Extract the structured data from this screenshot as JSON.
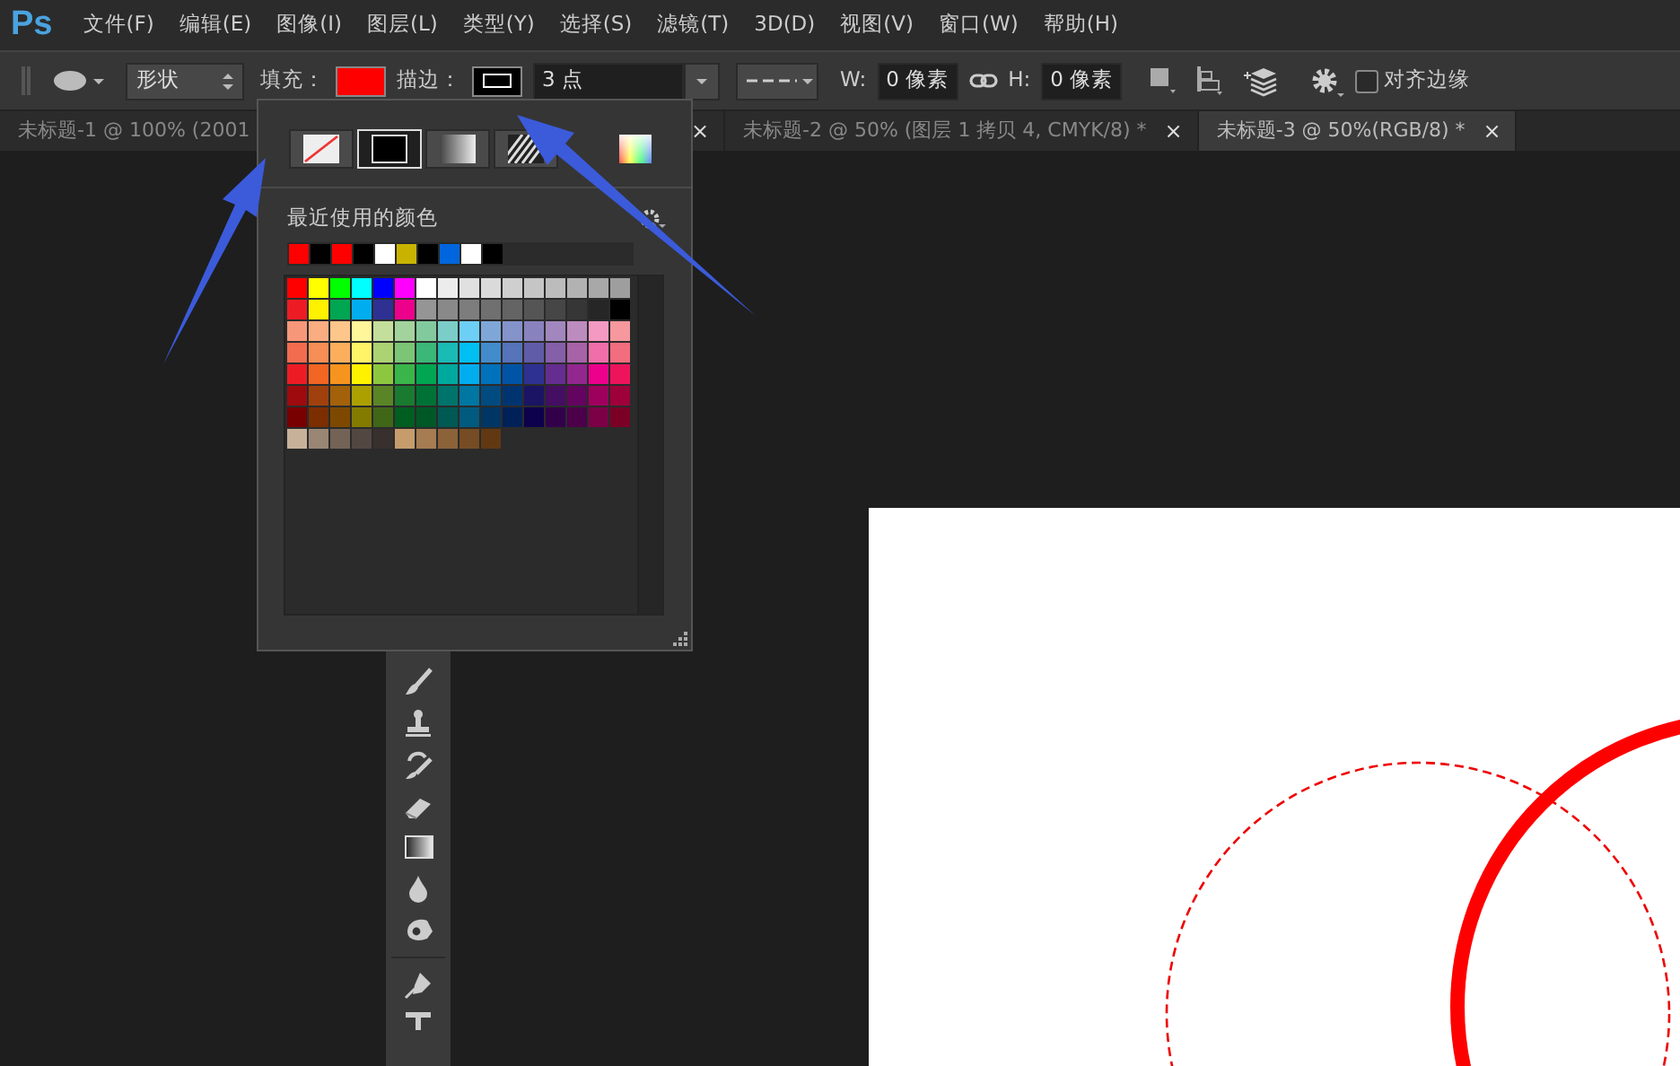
{
  "app_logo": "Ps",
  "menu": [
    "文件(F)",
    "编辑(E)",
    "图像(I)",
    "图层(L)",
    "类型(Y)",
    "选择(S)",
    "滤镜(T)",
    "3D(D)",
    "视图(V)",
    "窗口(W)",
    "帮助(H)"
  ],
  "options_bar": {
    "shape_mode": "形状",
    "fill_label": "填充：",
    "stroke_label": "描边：",
    "stroke_width": "3 点",
    "w_label": "W:",
    "w_value": "0 像素",
    "h_label": "H:",
    "h_value": "0 像素",
    "align_edges": {
      "label": "对齐边缘",
      "checked": false
    }
  },
  "tabs": [
    {
      "title": "未标题-1 @ 100% (2001",
      "close": "×",
      "selected": false
    },
    {
      "title": "未标题-2 @ 50% (图层 1 拷贝 4, CMYK/8) *",
      "close": "×",
      "selected": false
    },
    {
      "title": "未标题-3 @ 50%(RGB/8) *",
      "close": "×",
      "selected": true
    }
  ],
  "fill_popup": {
    "types": [
      {
        "kind": "none",
        "selected": false
      },
      {
        "kind": "solid",
        "selected": true
      },
      {
        "kind": "gradient",
        "selected": false
      },
      {
        "kind": "pattern",
        "selected": false
      }
    ],
    "recent_label": "最近使用的颜色",
    "recent": [
      {
        "color": "#ff0000"
      },
      {
        "color": "#000000"
      },
      {
        "color": "#ff0000"
      },
      {
        "color": "#000000"
      },
      {
        "color": "#ffffff"
      },
      {
        "color": "#c8b400"
      },
      {
        "color": "#000000"
      },
      {
        "color": "#0066dd"
      },
      {
        "color": "#ffffff"
      },
      {
        "color": "#000000"
      }
    ],
    "swatch_rows": [
      [
        {
          "color": "#ff0000"
        },
        {
          "color": "#ffff00"
        },
        {
          "color": "#00ff00"
        },
        {
          "color": "#00ffff"
        },
        {
          "color": "#0000ff"
        },
        {
          "color": "#ff00ff"
        },
        {
          "color": "#ffffff"
        },
        {
          "color": "#ececec"
        },
        {
          "color": "#e0e0e0"
        },
        {
          "color": "#dadada"
        },
        {
          "color": "#cfcfcf"
        },
        {
          "color": "#c5c5c5"
        },
        {
          "color": "#bcbcbc"
        },
        {
          "color": "#b2b2b2"
        },
        {
          "color": "#a8a8a8"
        },
        {
          "color": "#9e9e9e"
        }
      ],
      [
        {
          "color": "#ed1c24"
        },
        {
          "color": "#fff200"
        },
        {
          "color": "#00a651"
        },
        {
          "color": "#00aeef"
        },
        {
          "color": "#2e3192"
        },
        {
          "color": "#ec008c"
        },
        {
          "color": "#959595"
        },
        {
          "color": "#898989"
        },
        {
          "color": "#7d7d7d"
        },
        {
          "color": "#707070"
        },
        {
          "color": "#646464"
        },
        {
          "color": "#555555"
        },
        {
          "color": "#464646"
        },
        {
          "color": "#363636"
        },
        {
          "color": "#262626"
        },
        {
          "color": "#000000"
        }
      ],
      [
        {
          "color": "#f7977a"
        },
        {
          "color": "#f9ad81"
        },
        {
          "color": "#fdc68a"
        },
        {
          "color": "#fff79a"
        },
        {
          "color": "#c4df9b"
        },
        {
          "color": "#a3d39c"
        },
        {
          "color": "#82ca9d"
        },
        {
          "color": "#7bcdc8"
        },
        {
          "color": "#6ecff6"
        },
        {
          "color": "#7ea7d8"
        },
        {
          "color": "#8493ca"
        },
        {
          "color": "#8882be"
        },
        {
          "color": "#a187be"
        },
        {
          "color": "#bc8cbf"
        },
        {
          "color": "#f49ac2"
        },
        {
          "color": "#f6989d"
        }
      ],
      [
        {
          "color": "#f26c4f"
        },
        {
          "color": "#f68e55"
        },
        {
          "color": "#fbaf5c"
        },
        {
          "color": "#fff467"
        },
        {
          "color": "#acd372"
        },
        {
          "color": "#7cc576"
        },
        {
          "color": "#3bb878"
        },
        {
          "color": "#1abbb4"
        },
        {
          "color": "#00bff3"
        },
        {
          "color": "#438ccb"
        },
        {
          "color": "#5574b9"
        },
        {
          "color": "#605ca8"
        },
        {
          "color": "#855fa8"
        },
        {
          "color": "#a763a8"
        },
        {
          "color": "#f06ea9"
        },
        {
          "color": "#f26d7d"
        }
      ],
      [
        {
          "color": "#ed1c24"
        },
        {
          "color": "#f26522"
        },
        {
          "color": "#f7941d"
        },
        {
          "color": "#fff200"
        },
        {
          "color": "#8dc73f"
        },
        {
          "color": "#39b54a"
        },
        {
          "color": "#00a651"
        },
        {
          "color": "#00a99d"
        },
        {
          "color": "#00aeef"
        },
        {
          "color": "#0072bc"
        },
        {
          "color": "#0054a6"
        },
        {
          "color": "#2e3192"
        },
        {
          "color": "#662d91"
        },
        {
          "color": "#92278f"
        },
        {
          "color": "#ec008c"
        },
        {
          "color": "#ed145b"
        }
      ],
      [
        {
          "color": "#9e0b0f"
        },
        {
          "color": "#a0410d"
        },
        {
          "color": "#a36209"
        },
        {
          "color": "#aba000"
        },
        {
          "color": "#598527"
        },
        {
          "color": "#1a7b30"
        },
        {
          "color": "#007236"
        },
        {
          "color": "#00746b"
        },
        {
          "color": "#0076a3"
        },
        {
          "color": "#004b80"
        },
        {
          "color": "#003471"
        },
        {
          "color": "#1b1464"
        },
        {
          "color": "#440e62"
        },
        {
          "color": "#630460"
        },
        {
          "color": "#9e005d"
        },
        {
          "color": "#9e0039"
        }
      ],
      [
        {
          "color": "#790000"
        },
        {
          "color": "#7b2e00"
        },
        {
          "color": "#7d4900"
        },
        {
          "color": "#827b00"
        },
        {
          "color": "#406618"
        },
        {
          "color": "#005e20"
        },
        {
          "color": "#005826"
        },
        {
          "color": "#005952"
        },
        {
          "color": "#005b7f"
        },
        {
          "color": "#003663"
        },
        {
          "color": "#002157"
        },
        {
          "color": "#0d004c"
        },
        {
          "color": "#32004b"
        },
        {
          "color": "#4b0049"
        },
        {
          "color": "#7b0046"
        },
        {
          "color": "#7a0026"
        }
      ],
      [
        {
          "color": "#c7b299"
        },
        {
          "color": "#998675"
        },
        {
          "color": "#736357"
        },
        {
          "color": "#534741"
        },
        {
          "color": "#37302d"
        },
        {
          "color": "#c69c6d"
        },
        {
          "color": "#a67c52"
        },
        {
          "color": "#8c6239"
        },
        {
          "color": "#754c24"
        },
        {
          "color": "#603913"
        }
      ]
    ]
  }
}
